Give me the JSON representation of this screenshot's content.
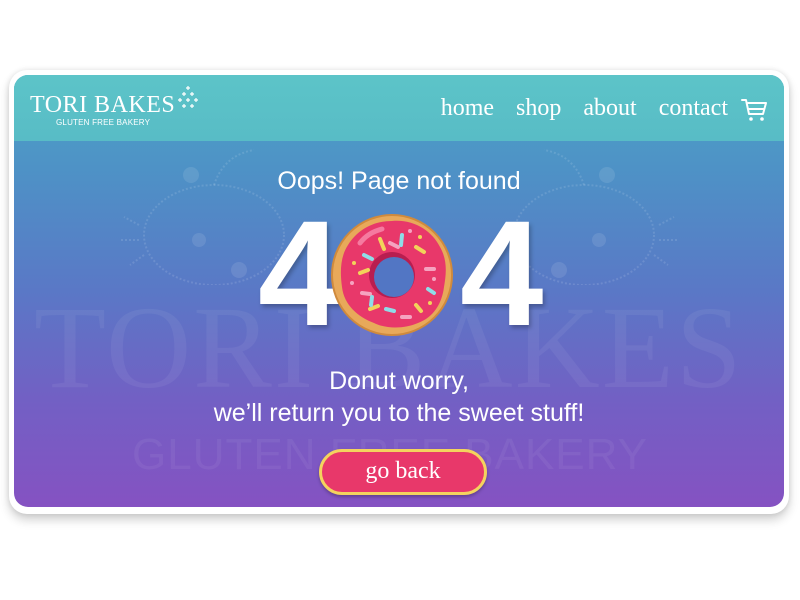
{
  "brand": {
    "name": "TORI BAKES",
    "tagline": "GLUTEN FREE BAKERY"
  },
  "nav": {
    "items": [
      {
        "label": "home"
      },
      {
        "label": "shop"
      },
      {
        "label": "about"
      },
      {
        "label": "contact"
      }
    ],
    "cart_icon": "shopping-cart-icon"
  },
  "error": {
    "heading": "Oops! Page not found",
    "code_left": "4",
    "code_right": "4",
    "code_middle_icon": "donut-icon",
    "message_line1": "Donut worry,",
    "message_line2": "we’ll return you to the sweet stuff!"
  },
  "actions": {
    "go_back_label": "go back"
  },
  "watermark": {
    "main": "TORI BAKES",
    "sub": "GLUTEN FREE BAKERY"
  },
  "colors": {
    "header": "#5cc4c8",
    "gradient_top": "#4aa5c6",
    "gradient_bottom": "#8552c2",
    "button": "#e8386a",
    "button_border": "#f4d35e",
    "icing": "#e8386a",
    "dough": "#e8a95a"
  }
}
